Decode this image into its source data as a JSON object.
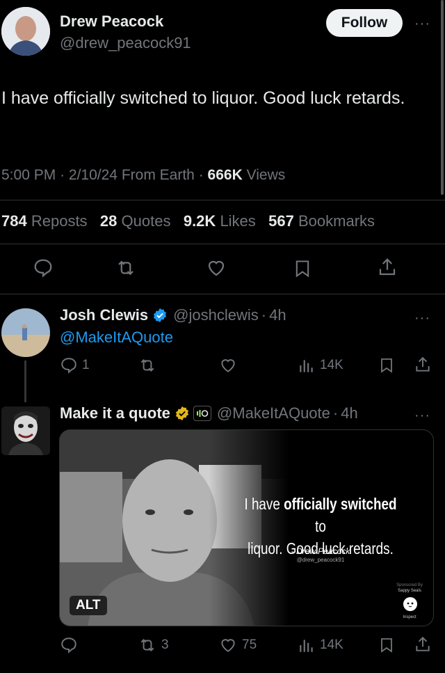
{
  "main_post": {
    "display_name": "Drew Peacock",
    "handle": "@drew_peacock91",
    "follow_label": "Follow",
    "more_label": "···",
    "text": "I have officially switched to liquor. Good luck retards.",
    "time": "5:00 PM",
    "date": "2/10/24",
    "source": "From Earth",
    "sep": "·",
    "views_count": "666K",
    "views_label": "Views",
    "stats": {
      "reposts_count": "784",
      "reposts_label": "Reposts",
      "quotes_count": "28",
      "quotes_label": "Quotes",
      "likes_count": "9.2K",
      "likes_label": "Likes",
      "bookmarks_count": "567",
      "bookmarks_label": "Bookmarks"
    }
  },
  "reply1": {
    "display_name": "Josh Clewis",
    "handle": "@joshclewis",
    "time": "4h",
    "sep": "·",
    "more_label": "···",
    "mention": "@MakeItAQuote",
    "reply_count": "1",
    "views_count": "14K"
  },
  "reply2": {
    "display_name": "Make it a quote",
    "handle": "@MakeItAQuote",
    "time": "4h",
    "sep": "·",
    "more_label": "···",
    "repost_count": "3",
    "like_count": "75",
    "views_count": "14K",
    "media": {
      "quote_line1_pre": "I have ",
      "quote_line1_bold": "officially switched",
      "quote_line1_post": " to",
      "quote_line2": "liquor. Good luck retards.",
      "attribution": "- Drew Peacock",
      "attribution_handle": "@drew_peacock91",
      "sponsored": "Sponsored By",
      "sponsor": "Sappy Seals",
      "inspect": "Inspect",
      "alt_label": "ALT"
    }
  },
  "colors": {
    "accent": "#1d9bf0",
    "verified_gold": "#e2b719",
    "muted": "#71767b",
    "divider": "#2f3336"
  }
}
